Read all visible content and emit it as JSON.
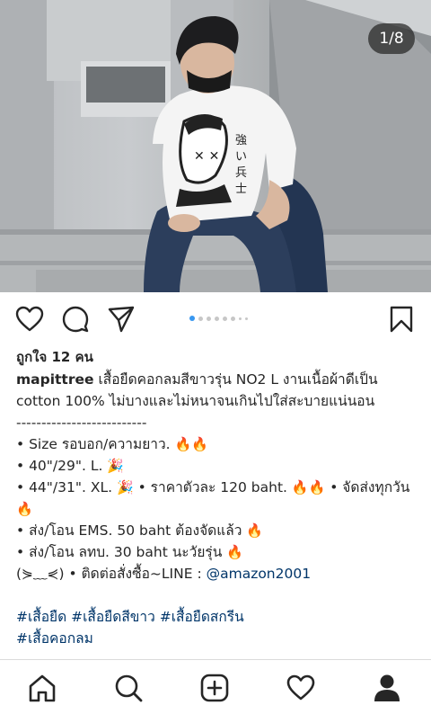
{
  "photo": {
    "counter": "1/8",
    "shirt_text": "強い兵士"
  },
  "actions": {
    "like_icon": "heart-icon",
    "comment_icon": "comment-icon",
    "share_icon": "send-icon",
    "save_icon": "bookmark-icon",
    "carousel_total": 8,
    "carousel_current": 1
  },
  "post": {
    "likes": "ถูกใจ 12 คน",
    "username": "mapittree",
    "caption_line1": " เสื้อยืดคอกลมสีขาวรุ่น NO2 L งานเนื้อผ้าดีเป็น",
    "caption_line2": "cotton 100% ไม่บางและไม่หนาจนเกินไปใส่สะบายแน่นอน",
    "divider": "--------------------------",
    "size_line": "• Size รอบอก/ความยาว.",
    "size_l": "• 40\"/29\". L.",
    "size_xl_a": "• 44\"/31\". XL.",
    "size_xl_b": "• ราคาตัวละ 120 baht.",
    "size_xl_c": "• จัดส่งทุกวัน",
    "ems": "• ส่ง/โอน EMS. 50 baht ต้องจัดแล้ว",
    "reg": "• ส่ง/โอน ลทบ. 30 baht นะวัยรุ่น",
    "contact_prefix": "(⋟﹏⋞) • ติดต่อสั่งซื้อ~LINE : ",
    "line_id": "@amazon2001",
    "hashtags_1": "#เสื้อยืด #เสื้อยืดสีขาว #เสื้อยืดสกรีน",
    "hashtags_2": "#เสื้อคอกลม",
    "fire": "🔥",
    "party": "🎉"
  },
  "nav": {
    "items": [
      "home-icon",
      "search-icon",
      "add-post-icon",
      "activity-heart-icon",
      "profile-icon"
    ]
  }
}
